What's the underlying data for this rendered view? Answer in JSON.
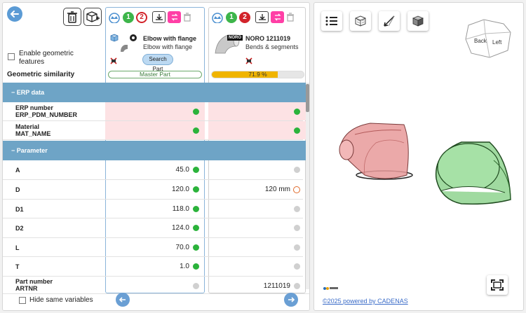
{
  "left": {
    "enable_geometric_label": "Enable geometric features",
    "geometric_similarity_label": "Geometric similarity",
    "hide_same_label": "Hide same variables"
  },
  "columns": [
    {
      "badge_green": "1",
      "badge_red": "2",
      "title": "Elbow with flange",
      "subtitle": "Elbow with flange",
      "search_button": "Search Part",
      "master_label": "Master Part"
    },
    {
      "badge_green": "1",
      "badge_red": "2",
      "brand": "NORO",
      "title": "NORO 1211019",
      "subtitle": "Bends & segments",
      "similarity_text": "71.9 %",
      "similarity": 71.9
    }
  ],
  "sections": {
    "erp": "ERP data",
    "parameter": "Parameter"
  },
  "rows": {
    "erp_number": {
      "label1": "ERP number",
      "label2": "ERP_PDM_NUMBER"
    },
    "material": {
      "label1": "Material",
      "label2": "MAT_NAME"
    },
    "A": {
      "label": "A",
      "v1": "45.0",
      "v2": ""
    },
    "D": {
      "label": "D",
      "v1": "120.0",
      "v2": "120 mm"
    },
    "D1": {
      "label": "D1",
      "v1": "118.0",
      "v2": ""
    },
    "D2": {
      "label": "D2",
      "v1": "124.0",
      "v2": ""
    },
    "L": {
      "label": "L",
      "v1": "70.0",
      "v2": ""
    },
    "T": {
      "label": "T",
      "v1": "1.0",
      "v2": ""
    },
    "part_number": {
      "label1": "Part number",
      "label2": "ARTNR",
      "v1": "",
      "v2": "1211019"
    }
  },
  "viewer": {
    "cube_back": "Back",
    "cube_left": "Left",
    "footer": "©2025 powered by CADENAS",
    "colors": {
      "master": "#e89a9a",
      "candidate": "#8fd48f"
    }
  },
  "colors": {
    "section": "#6ea4c6",
    "pink_cell": "#fde2e4",
    "green": "#2bb33b",
    "progress": "#f0b400",
    "pink_button": "#ff3fa6"
  }
}
